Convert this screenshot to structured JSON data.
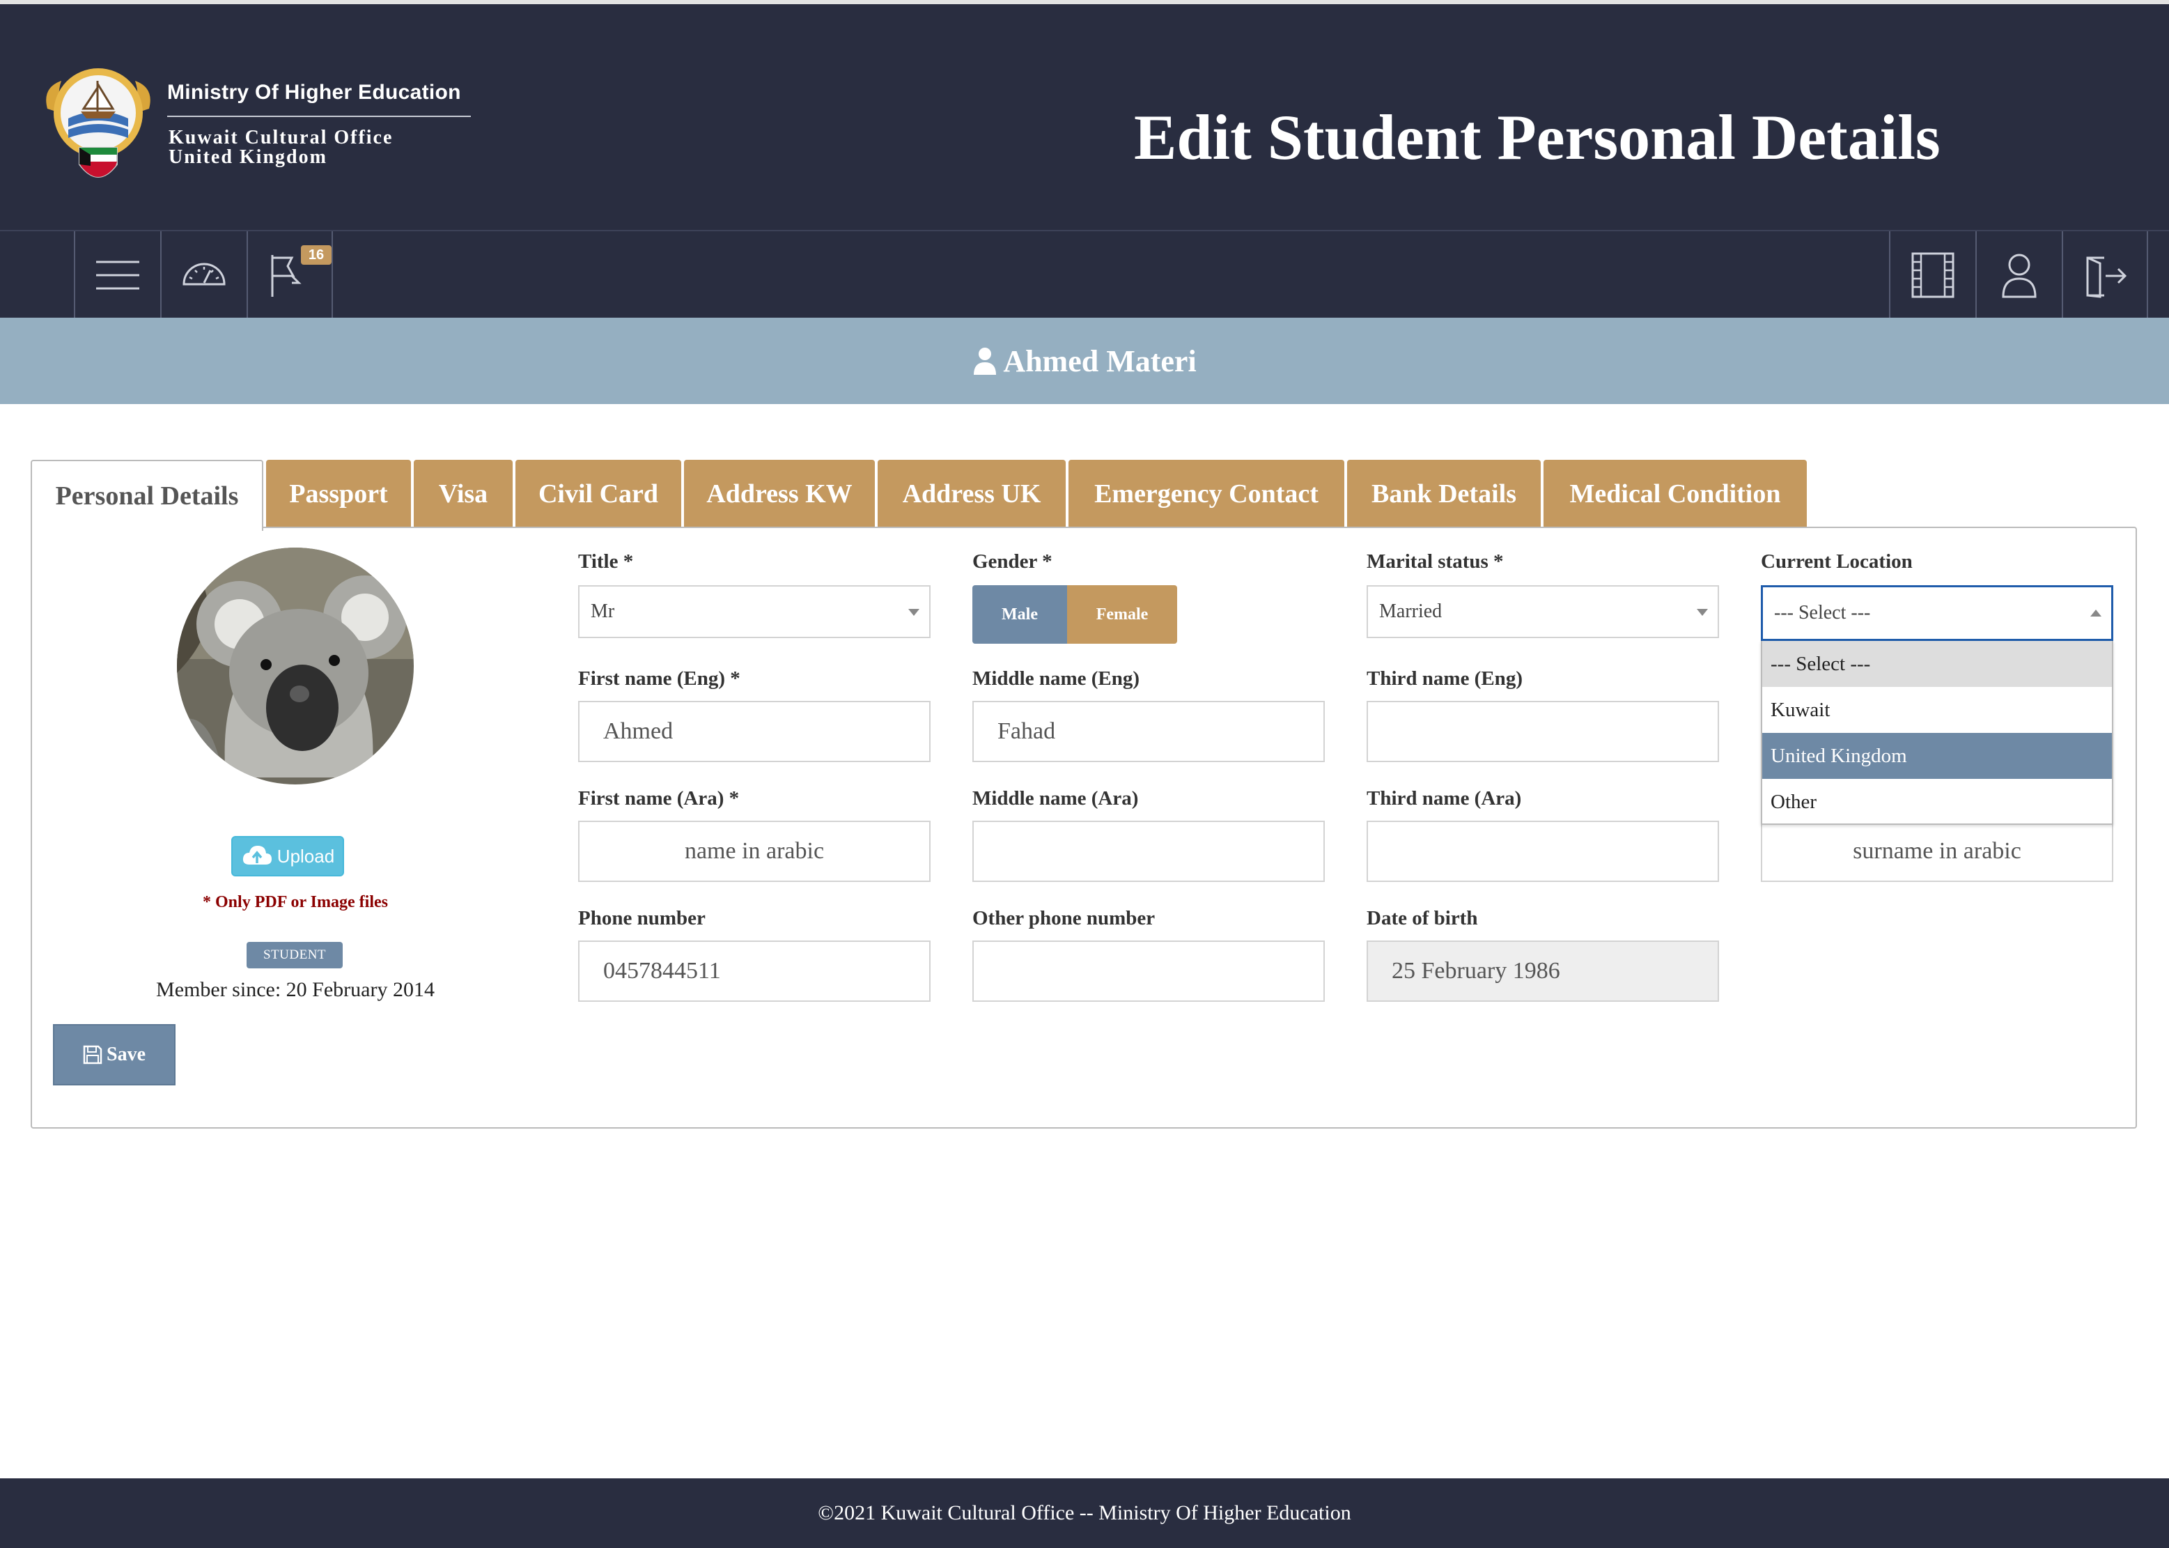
{
  "header": {
    "ministry_name": "Ministry Of Higher Education",
    "office_line1": "Kuwait Cultural Office",
    "office_line2": "United Kingdom",
    "page_title": "Edit Student Personal Details"
  },
  "toolbar": {
    "left_icons": [
      "menu-icon",
      "dashboard-gauge-icon",
      "flag-icon"
    ],
    "flag_badge_count": "16",
    "right_icons": [
      "film-icon",
      "user-icon",
      "logout-icon"
    ]
  },
  "user_bar": {
    "user_name": "Ahmed Materi"
  },
  "tabs": [
    {
      "label": "Personal Details",
      "active": true
    },
    {
      "label": "Passport",
      "active": false
    },
    {
      "label": "Visa",
      "active": false
    },
    {
      "label": "Civil Card",
      "active": false
    },
    {
      "label": "Address KW",
      "active": false
    },
    {
      "label": "Address UK",
      "active": false
    },
    {
      "label": "Emergency Contact",
      "active": false
    },
    {
      "label": "Bank Details",
      "active": false
    },
    {
      "label": "Medical Condition",
      "active": false
    }
  ],
  "profile": {
    "upload_label": "Upload",
    "file_note": "* Only PDF or Image files",
    "role_badge": "STUDENT",
    "member_since": "Member since: 20 February 2014",
    "save_label": "Save"
  },
  "form": {
    "title": {
      "label": "Title  *",
      "value": "Mr"
    },
    "gender": {
      "label": "Gender  *",
      "options": [
        "Male",
        "Female"
      ],
      "selected": "Male"
    },
    "marital_status": {
      "label": "Marital status  *",
      "value": "Married"
    },
    "current_location": {
      "label": "Current Location",
      "value": "--- Select ---",
      "options": [
        "--- Select ---",
        "Kuwait",
        "United Kingdom",
        "Other"
      ],
      "highlighted": "United Kingdom"
    },
    "first_name_eng": {
      "label": "First name (Eng)  *",
      "value": "Ahmed"
    },
    "middle_name_eng": {
      "label": "Middle name (Eng)",
      "value": "Fahad"
    },
    "third_name_eng": {
      "label": "Third name (Eng)",
      "value": ""
    },
    "first_name_ara": {
      "label": "First name (Ara)  *",
      "value": "name in arabic"
    },
    "middle_name_ara": {
      "label": "Middle name (Ara)",
      "value": ""
    },
    "third_name_ara": {
      "label": "Third name (Ara)",
      "value": ""
    },
    "surname_ara": {
      "value": "surname in arabic"
    },
    "phone": {
      "label": "Phone number",
      "value": "0457844511"
    },
    "other_phone": {
      "label": "Other phone number",
      "value": ""
    },
    "dob": {
      "label": "Date of birth",
      "value": "25 February 1986"
    }
  },
  "footer": {
    "text": "©2021 Kuwait Cultural Office -- Ministry Of Higher Education"
  },
  "colors": {
    "header_bg": "#292d40",
    "user_bar_bg": "#95afc1",
    "tab_bg": "#c4995f",
    "accent_blue": "#6e89a5",
    "upload_bg": "#5bc0de"
  }
}
